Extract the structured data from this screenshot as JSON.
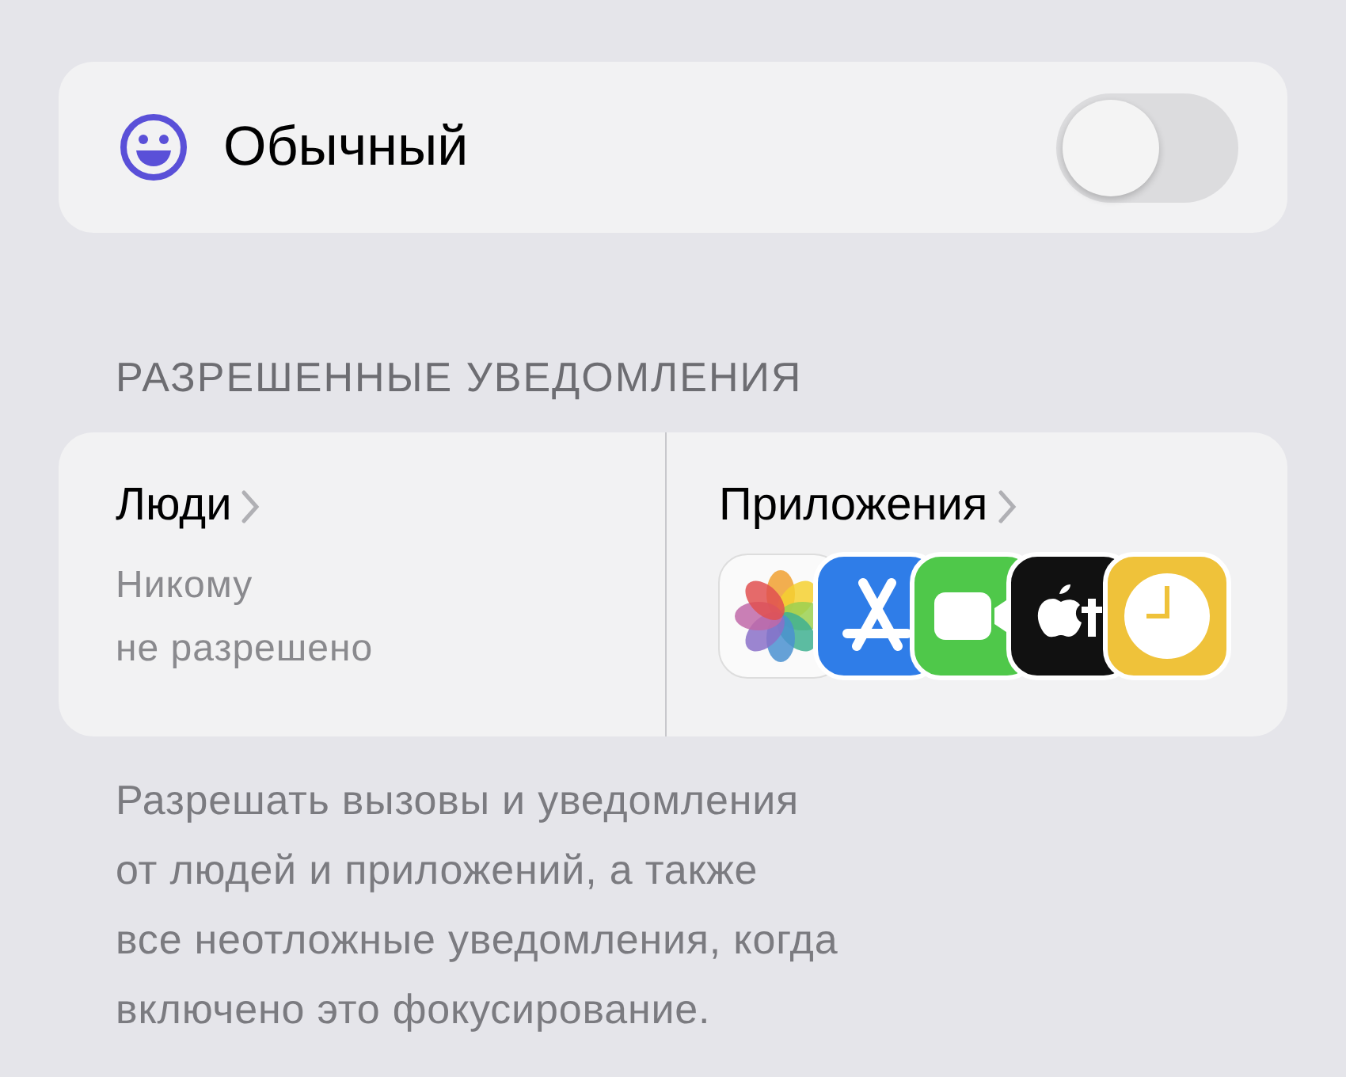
{
  "focus": {
    "title": "Обычный",
    "on": false
  },
  "section_header": "РАЗРЕШЕННЫЕ УВЕДОМЛЕНИЯ",
  "allowed": [
    {
      "title": "Люди",
      "subtitle_lines": [
        "Никому",
        "не разрешено"
      ]
    },
    {
      "title": "Приложения",
      "apps": [
        {
          "kind": "photos"
        },
        {
          "kind": "appstore"
        },
        {
          "kind": "facetime"
        },
        {
          "kind": "tv"
        },
        {
          "kind": "clock"
        }
      ]
    }
  ],
  "footer_lines": [
    "Разрешать вызовы и уведомления",
    "от людей и приложений, а также",
    "все неотложные уведомления, когда",
    "включено это фокусирование."
  ]
}
